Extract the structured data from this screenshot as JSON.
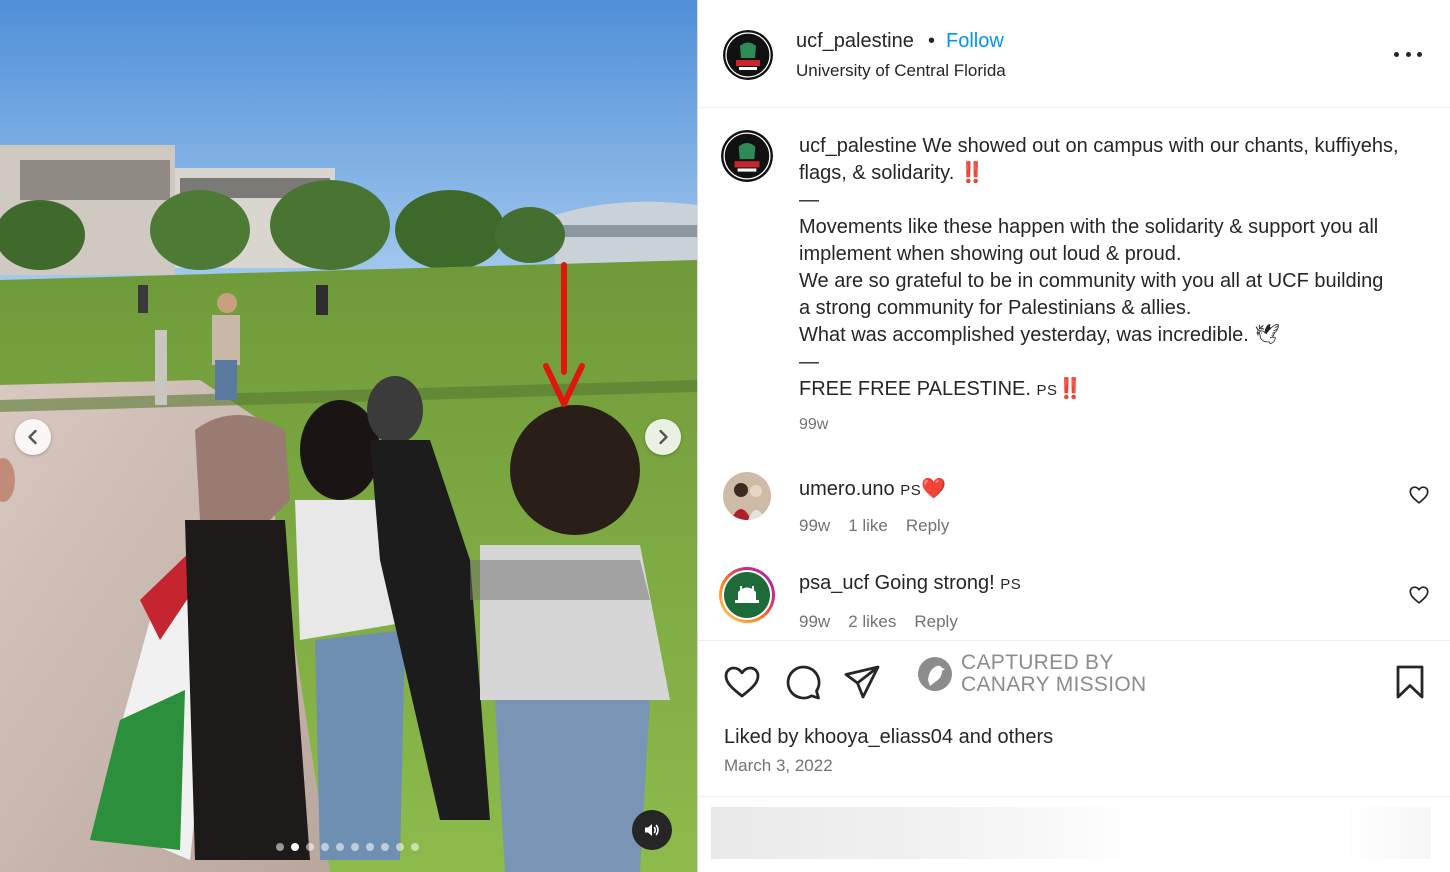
{
  "post": {
    "username": "ucf_palestine",
    "separator": "•",
    "follow_label": "Follow",
    "location": "University of Central Florida"
  },
  "caption": {
    "username": "ucf_palestine",
    "line1": " We showed out on campus with our chants, kuffiyehs, flags, & solidarity. ‼️",
    "sep1": "—",
    "line2": "Movements like these happen with the solidarity & support you all implement when showing out loud & proud.",
    "line3": "We are so grateful to be in community with you all at UCF building a strong community for Palestinians & allies.",
    "line4": "What was accomplished yesterday, was incredible. 🕊",
    "sep2": "—",
    "line5": "FREE FREE PALESTINE. ",
    "line5_flag": "PS",
    "line5_end": "‼️",
    "time": "99w"
  },
  "comments": [
    {
      "username": "umero.uno",
      "text": " ",
      "flag": "PS",
      "emoji": "❤️",
      "time": "99w",
      "likes": "1 like",
      "reply": "Reply"
    },
    {
      "username": "psa_ucf",
      "text": " Going strong! ",
      "flag": "PS",
      "emoji": "",
      "time": "99w",
      "likes": "2 likes",
      "reply": "Reply"
    }
  ],
  "watermark": {
    "line1": "CAPTURED BY",
    "line2": "CANARY MISSION"
  },
  "likes": {
    "prefix": "Liked by ",
    "user": "khooya_eliass04",
    "middle": " and ",
    "others": "others"
  },
  "date": "March 3, 2022",
  "comment_input": {
    "placeholder": ""
  },
  "carousel": {
    "total_slides": 10,
    "active_slide": 2
  },
  "icons": [
    "chevron-left-icon",
    "chevron-right-icon",
    "speaker-icon",
    "more-icon",
    "heart-icon",
    "comment-icon",
    "share-icon",
    "bookmark-icon",
    "canary-logo-icon"
  ],
  "colors": {
    "follow": "#0095f6",
    "muted_text": "#737373",
    "annotation_arrow": "#e3150f"
  }
}
